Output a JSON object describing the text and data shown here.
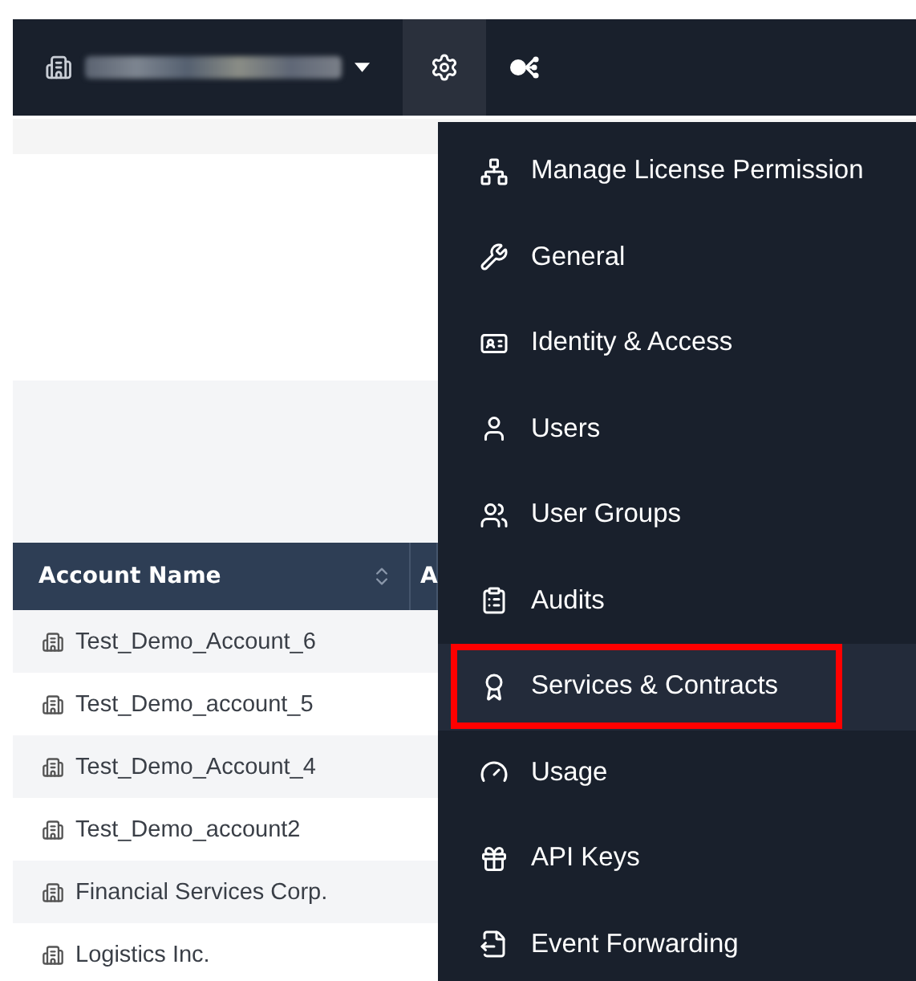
{
  "navbar": {
    "settings_selected": true
  },
  "settings_menu": {
    "items": [
      {
        "kind": "permissions",
        "label": "Manage License Permission",
        "selected": false,
        "outlined": false
      },
      {
        "kind": "general",
        "label": "General",
        "selected": false,
        "outlined": false
      },
      {
        "kind": "identity",
        "label": "Identity & Access",
        "selected": false,
        "outlined": false
      },
      {
        "kind": "user",
        "label": "Users",
        "selected": false,
        "outlined": false
      },
      {
        "kind": "groups",
        "label": "User Groups",
        "selected": false,
        "outlined": false
      },
      {
        "kind": "audits",
        "label": "Audits",
        "selected": false,
        "outlined": false
      },
      {
        "kind": "services",
        "label": "Services & Contracts",
        "selected": true,
        "outlined": true
      },
      {
        "kind": "usage",
        "label": "Usage",
        "selected": false,
        "outlined": false
      },
      {
        "kind": "keys",
        "label": "API Keys",
        "selected": false,
        "outlined": false
      },
      {
        "kind": "forwarding",
        "label": "Event Forwarding",
        "selected": false,
        "outlined": false
      }
    ]
  },
  "table": {
    "columns": [
      {
        "label": "Account Name",
        "sortable": true
      },
      {
        "label": "A"
      }
    ],
    "rows": [
      {
        "account_name": "Test_Demo_Account_6"
      },
      {
        "account_name": "Test_Demo_account_5"
      },
      {
        "account_name": "Test_Demo_Account_4"
      },
      {
        "account_name": "Test_Demo_account2"
      },
      {
        "account_name": "Financial Services Corp."
      },
      {
        "account_name": "Logistics Inc."
      }
    ]
  }
}
